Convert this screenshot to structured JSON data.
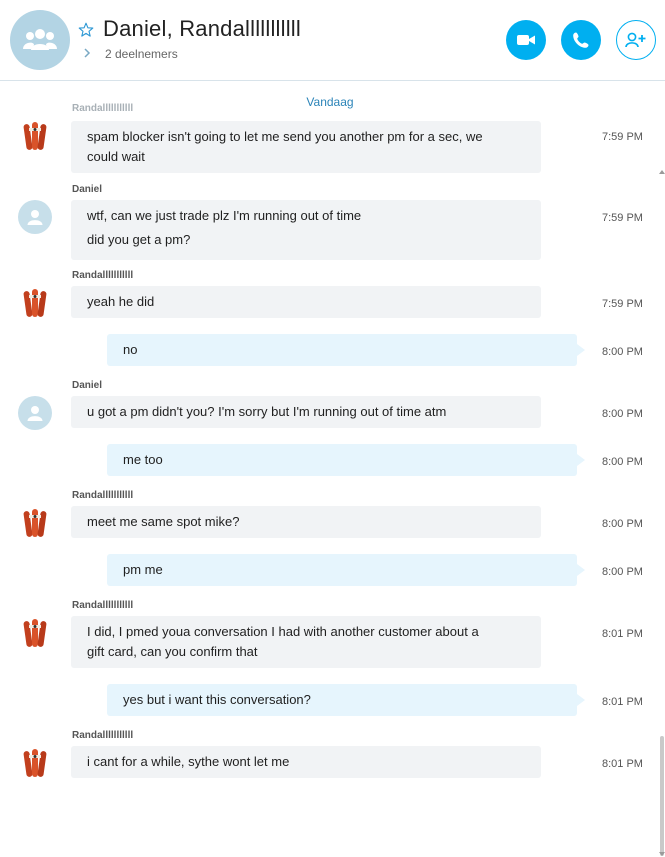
{
  "header": {
    "title": "Daniel, Randalllllllllll",
    "participants": "2 deelnemers"
  },
  "chat": {
    "date_separator": "Vandaag",
    "senders": {
      "randall": "Randalllllllllll",
      "daniel": "Daniel"
    },
    "messages": [
      {
        "lines": [
          "spam blocker isn't going to let me send you another pm for a sec, we",
          "could wait"
        ],
        "time": "7:59 PM"
      },
      {
        "lines": [
          "wtf, can we just trade plz I'm running out of time"
        ],
        "time": "7:59 PM"
      },
      {
        "lines": [
          "did you get a pm?"
        ]
      },
      {
        "lines": [
          "yeah he did"
        ],
        "time": "7:59 PM"
      },
      {
        "lines": [
          "no"
        ],
        "time": "8:00 PM"
      },
      {
        "lines": [
          "u got a pm didn't you? I'm sorry but I'm running out of time atm"
        ],
        "time": "8:00 PM"
      },
      {
        "lines": [
          "me too"
        ],
        "time": "8:00 PM"
      },
      {
        "lines": [
          "meet me same spot mike?"
        ],
        "time": "8:00 PM"
      },
      {
        "lines": [
          "pm me"
        ],
        "time": "8:00 PM"
      },
      {
        "lines": [
          "I did, I pmed  youa conversation I had with another customer about a",
          "gift card, can you confirm that"
        ],
        "time": "8:01 PM"
      },
      {
        "lines": [
          "yes but i want this conversation?"
        ],
        "time": "8:01 PM"
      },
      {
        "lines": [
          "i cant for a while, sythe wont let me"
        ],
        "time": "8:01 PM"
      }
    ]
  }
}
